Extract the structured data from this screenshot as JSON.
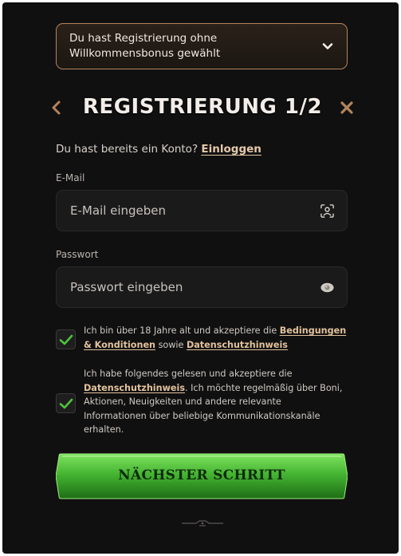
{
  "bonus_banner": {
    "text": "Du hast Registrierung ohne Willkommensbonus gewählt"
  },
  "header": {
    "title": "REGISTRIERUNG 1/2",
    "back_icon": "chevron-left-icon",
    "close_icon": "close-icon"
  },
  "login": {
    "prompt": "Du hast bereits ein Konto?",
    "link": "Einloggen"
  },
  "email": {
    "label": "E-Mail",
    "placeholder": "E-Mail eingeben",
    "value": "",
    "icon": "face-scan-icon"
  },
  "password": {
    "label": "Passwort",
    "placeholder": "Passwort eingeben",
    "value": "",
    "icon": "eye-icon"
  },
  "consent_age": {
    "checked": true,
    "text_before": "Ich bin über 18 Jahre alt und akzeptiere die",
    "link_terms": "Bedingungen & Konditionen",
    "text_middle": "sowie",
    "link_privacy": "Datenschutzhinweis"
  },
  "consent_marketing": {
    "checked": true,
    "text_before": "Ich habe folgendes gelesen und akzeptiere die",
    "link_privacy": "Datenschutzhinweis",
    "text_after": ". Ich möchte regelmäßig über Boni, Aktionen, Neuigkeiten und andere relevante Informationen über beliebige Kommunikationskanäle erhalten."
  },
  "next_button": {
    "label": "NÄCHSTER SCHRITT"
  },
  "colors": {
    "background": "#111011",
    "accent": "#b4845a",
    "link": "#e2c29c",
    "button_green": "#3fae2f",
    "check_green": "#4fc23c"
  }
}
